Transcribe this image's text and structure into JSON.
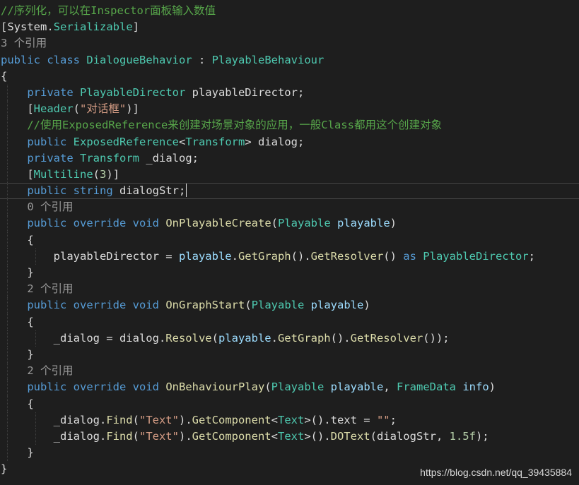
{
  "colors": {
    "background": "#1e1e1e",
    "plain": "#dcdcdc",
    "keyword": "#569cd6",
    "type": "#4ec9b0",
    "comment": "#57a64a",
    "string": "#d69d85",
    "number": "#b5cea8",
    "codelens": "#999999",
    "parameter": "#9cdcfe",
    "method": "#dcdcaa"
  },
  "code_lines": [
    {
      "indent": 0,
      "current": false,
      "tokens": [
        {
          "t": "//序列化，可以在Inspector面板输入数值",
          "k": "comment"
        }
      ]
    },
    {
      "indent": 0,
      "current": false,
      "tokens": [
        {
          "t": "[",
          "k": "plain"
        },
        {
          "t": "System",
          "k": "plain"
        },
        {
          "t": ".",
          "k": "plain"
        },
        {
          "t": "Serializable",
          "k": "type"
        },
        {
          "t": "]",
          "k": "plain"
        }
      ]
    },
    {
      "indent": 0,
      "current": false,
      "tokens": [
        {
          "t": "3 个引用",
          "k": "codelens"
        }
      ]
    },
    {
      "indent": 0,
      "current": false,
      "tokens": [
        {
          "t": "public",
          "k": "keyword"
        },
        {
          "t": " ",
          "k": "plain"
        },
        {
          "t": "class",
          "k": "keyword"
        },
        {
          "t": " ",
          "k": "plain"
        },
        {
          "t": "DialogueBehavior",
          "k": "type"
        },
        {
          "t": " : ",
          "k": "plain"
        },
        {
          "t": "PlayableBehaviour",
          "k": "type"
        }
      ]
    },
    {
      "indent": 0,
      "current": false,
      "tokens": [
        {
          "t": "{",
          "k": "plain"
        }
      ]
    },
    {
      "indent": 1,
      "current": false,
      "tokens": [
        {
          "t": "private",
          "k": "keyword"
        },
        {
          "t": " ",
          "k": "plain"
        },
        {
          "t": "PlayableDirector",
          "k": "type"
        },
        {
          "t": " playableDirector;",
          "k": "plain"
        }
      ]
    },
    {
      "indent": 1,
      "current": false,
      "tokens": [
        {
          "t": "[",
          "k": "plain"
        },
        {
          "t": "Header",
          "k": "type"
        },
        {
          "t": "(",
          "k": "plain"
        },
        {
          "t": "\"对话框\"",
          "k": "string"
        },
        {
          "t": ")]",
          "k": "plain"
        }
      ]
    },
    {
      "indent": 1,
      "current": false,
      "tokens": [
        {
          "t": "//使用ExposedReference来创建对场景对象的应用，一般Class都用这个创建对象",
          "k": "comment"
        }
      ]
    },
    {
      "indent": 1,
      "current": false,
      "tokens": [
        {
          "t": "public",
          "k": "keyword"
        },
        {
          "t": " ",
          "k": "plain"
        },
        {
          "t": "ExposedReference",
          "k": "type"
        },
        {
          "t": "<",
          "k": "plain"
        },
        {
          "t": "Transform",
          "k": "type"
        },
        {
          "t": "> dialog;",
          "k": "plain"
        }
      ]
    },
    {
      "indent": 1,
      "current": false,
      "tokens": [
        {
          "t": "private",
          "k": "keyword"
        },
        {
          "t": " ",
          "k": "plain"
        },
        {
          "t": "Transform",
          "k": "type"
        },
        {
          "t": " _dialog;",
          "k": "plain"
        }
      ]
    },
    {
      "indent": 1,
      "current": false,
      "tokens": [
        {
          "t": "[",
          "k": "plain"
        },
        {
          "t": "Multiline",
          "k": "type"
        },
        {
          "t": "(",
          "k": "plain"
        },
        {
          "t": "3",
          "k": "number"
        },
        {
          "t": ")]",
          "k": "plain"
        }
      ]
    },
    {
      "indent": 1,
      "current": true,
      "caret": true,
      "tokens": [
        {
          "t": "public",
          "k": "keyword"
        },
        {
          "t": " ",
          "k": "plain"
        },
        {
          "t": "string",
          "k": "keyword"
        },
        {
          "t": " dialogStr;",
          "k": "plain"
        }
      ]
    },
    {
      "indent": 1,
      "current": false,
      "tokens": [
        {
          "t": "0 个引用",
          "k": "codelens"
        }
      ]
    },
    {
      "indent": 1,
      "current": false,
      "tokens": [
        {
          "t": "public",
          "k": "keyword"
        },
        {
          "t": " ",
          "k": "plain"
        },
        {
          "t": "override",
          "k": "keyword"
        },
        {
          "t": " ",
          "k": "plain"
        },
        {
          "t": "void",
          "k": "keyword"
        },
        {
          "t": " ",
          "k": "plain"
        },
        {
          "t": "OnPlayableCreate",
          "k": "method"
        },
        {
          "t": "(",
          "k": "plain"
        },
        {
          "t": "Playable",
          "k": "type"
        },
        {
          "t": " ",
          "k": "plain"
        },
        {
          "t": "playable",
          "k": "parameter"
        },
        {
          "t": ")",
          "k": "plain"
        }
      ]
    },
    {
      "indent": 1,
      "current": false,
      "tokens": [
        {
          "t": "{",
          "k": "plain"
        }
      ]
    },
    {
      "indent": 2,
      "current": false,
      "tokens": [
        {
          "t": "playableDirector = ",
          "k": "plain"
        },
        {
          "t": "playable",
          "k": "parameter"
        },
        {
          "t": ".",
          "k": "plain"
        },
        {
          "t": "GetGraph",
          "k": "method"
        },
        {
          "t": "().",
          "k": "plain"
        },
        {
          "t": "GetResolver",
          "k": "method"
        },
        {
          "t": "() ",
          "k": "plain"
        },
        {
          "t": "as",
          "k": "keyword"
        },
        {
          "t": " ",
          "k": "plain"
        },
        {
          "t": "PlayableDirector",
          "k": "type"
        },
        {
          "t": ";",
          "k": "plain"
        }
      ]
    },
    {
      "indent": 1,
      "current": false,
      "tokens": [
        {
          "t": "}",
          "k": "plain"
        }
      ]
    },
    {
      "indent": 1,
      "current": false,
      "tokens": [
        {
          "t": "2 个引用",
          "k": "codelens"
        }
      ]
    },
    {
      "indent": 1,
      "current": false,
      "tokens": [
        {
          "t": "public",
          "k": "keyword"
        },
        {
          "t": " ",
          "k": "plain"
        },
        {
          "t": "override",
          "k": "keyword"
        },
        {
          "t": " ",
          "k": "plain"
        },
        {
          "t": "void",
          "k": "keyword"
        },
        {
          "t": " ",
          "k": "plain"
        },
        {
          "t": "OnGraphStart",
          "k": "method"
        },
        {
          "t": "(",
          "k": "plain"
        },
        {
          "t": "Playable",
          "k": "type"
        },
        {
          "t": " ",
          "k": "plain"
        },
        {
          "t": "playable",
          "k": "parameter"
        },
        {
          "t": ")",
          "k": "plain"
        }
      ]
    },
    {
      "indent": 1,
      "current": false,
      "tokens": [
        {
          "t": "{",
          "k": "plain"
        }
      ]
    },
    {
      "indent": 2,
      "current": false,
      "tokens": [
        {
          "t": "_dialog = dialog.",
          "k": "plain"
        },
        {
          "t": "Resolve",
          "k": "method"
        },
        {
          "t": "(",
          "k": "plain"
        },
        {
          "t": "playable",
          "k": "parameter"
        },
        {
          "t": ".",
          "k": "plain"
        },
        {
          "t": "GetGraph",
          "k": "method"
        },
        {
          "t": "().",
          "k": "plain"
        },
        {
          "t": "GetResolver",
          "k": "method"
        },
        {
          "t": "());",
          "k": "plain"
        }
      ]
    },
    {
      "indent": 1,
      "current": false,
      "tokens": [
        {
          "t": "}",
          "k": "plain"
        }
      ]
    },
    {
      "indent": 1,
      "current": false,
      "tokens": [
        {
          "t": "2 个引用",
          "k": "codelens"
        }
      ]
    },
    {
      "indent": 1,
      "current": false,
      "tokens": [
        {
          "t": "public",
          "k": "keyword"
        },
        {
          "t": " ",
          "k": "plain"
        },
        {
          "t": "override",
          "k": "keyword"
        },
        {
          "t": " ",
          "k": "plain"
        },
        {
          "t": "void",
          "k": "keyword"
        },
        {
          "t": " ",
          "k": "plain"
        },
        {
          "t": "OnBehaviourPlay",
          "k": "method"
        },
        {
          "t": "(",
          "k": "plain"
        },
        {
          "t": "Playable",
          "k": "type"
        },
        {
          "t": " ",
          "k": "plain"
        },
        {
          "t": "playable",
          "k": "parameter"
        },
        {
          "t": ", ",
          "k": "plain"
        },
        {
          "t": "FrameData",
          "k": "type"
        },
        {
          "t": " ",
          "k": "plain"
        },
        {
          "t": "info",
          "k": "parameter"
        },
        {
          "t": ")",
          "k": "plain"
        }
      ]
    },
    {
      "indent": 1,
      "current": false,
      "tokens": [
        {
          "t": "{",
          "k": "plain"
        }
      ]
    },
    {
      "indent": 2,
      "current": false,
      "tokens": [
        {
          "t": "_dialog.",
          "k": "plain"
        },
        {
          "t": "Find",
          "k": "method"
        },
        {
          "t": "(",
          "k": "plain"
        },
        {
          "t": "\"Text\"",
          "k": "string"
        },
        {
          "t": ").",
          "k": "plain"
        },
        {
          "t": "GetComponent",
          "k": "method"
        },
        {
          "t": "<",
          "k": "plain"
        },
        {
          "t": "Text",
          "k": "type"
        },
        {
          "t": ">().text = ",
          "k": "plain"
        },
        {
          "t": "\"\"",
          "k": "string"
        },
        {
          "t": ";",
          "k": "plain"
        }
      ]
    },
    {
      "indent": 2,
      "current": false,
      "tokens": [
        {
          "t": "_dialog.",
          "k": "plain"
        },
        {
          "t": "Find",
          "k": "method"
        },
        {
          "t": "(",
          "k": "plain"
        },
        {
          "t": "\"Text\"",
          "k": "string"
        },
        {
          "t": ").",
          "k": "plain"
        },
        {
          "t": "GetComponent",
          "k": "method"
        },
        {
          "t": "<",
          "k": "plain"
        },
        {
          "t": "Text",
          "k": "type"
        },
        {
          "t": ">().",
          "k": "plain"
        },
        {
          "t": "DOText",
          "k": "method"
        },
        {
          "t": "(dialogStr, ",
          "k": "plain"
        },
        {
          "t": "1.5f",
          "k": "number"
        },
        {
          "t": ");",
          "k": "plain"
        }
      ]
    },
    {
      "indent": 1,
      "current": false,
      "tokens": [
        {
          "t": "}",
          "k": "plain"
        }
      ]
    },
    {
      "indent": 0,
      "current": false,
      "tokens": [
        {
          "t": "}",
          "k": "plain"
        }
      ]
    }
  ],
  "watermark": "https://blog.csdn.net/qq_39435884"
}
